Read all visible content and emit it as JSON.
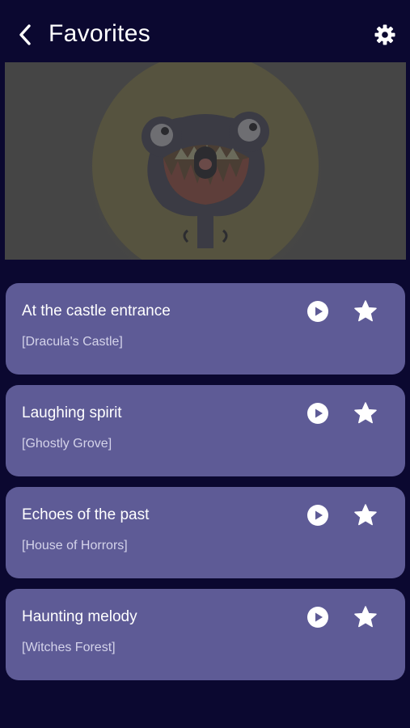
{
  "header": {
    "title": "Favorites",
    "back_icon": "chevron-left-icon",
    "settings_icon": "gear-icon"
  },
  "banner": {
    "image": "monster-illustration"
  },
  "favorites": [
    {
      "title": "At the castle entrance",
      "location": "[Dracula's Castle]"
    },
    {
      "title": "Laughing spirit",
      "location": "[Ghostly Grove]"
    },
    {
      "title": "Echoes of the past",
      "location": "[House of Horrors]"
    },
    {
      "title": "Haunting melody",
      "location": "[Witches Forest]"
    }
  ],
  "colors": {
    "background": "#0b0830",
    "card": "#5e5b96",
    "banner": "#454545",
    "text": "#ffffff",
    "subtext": "#d4d3ea"
  }
}
